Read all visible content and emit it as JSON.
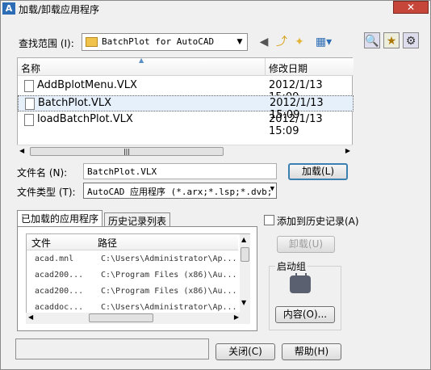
{
  "window": {
    "title": "加载/卸载应用程序",
    "close": "✕"
  },
  "lookin": {
    "label": "查找范围 (I):",
    "value": "BatchPlot for AutoCAD"
  },
  "toolbar": [
    "back-icon",
    "up-folder-icon",
    "new-folder-icon",
    "views-menu-icon",
    "search-web-icon",
    "favorites-icon",
    "tools-icon"
  ],
  "filelist": {
    "col_name": "名称",
    "col_date": "修改日期",
    "rows": [
      {
        "name": "AddBplotMenu.VLX",
        "date": "2012/1/13 15:09"
      },
      {
        "name": "BatchPlot.VLX",
        "date": "2012/1/13 15:09",
        "selected": true
      },
      {
        "name": "loadBatchPlot.VLX",
        "date": "2012/1/13 15:09"
      }
    ]
  },
  "filename": {
    "label": "文件名 (N):",
    "value": "BatchPlot.VLX"
  },
  "filetype": {
    "label": "文件类型 (T):",
    "value": "AutoCAD 应用程序 (*.arx;*.lsp;*.dvb;"
  },
  "load_button": "加载(L)",
  "tabs": {
    "loaded": "已加载的应用程序",
    "history": "历史记录列表"
  },
  "applist": {
    "col_file": "文件",
    "col_path": "路径",
    "rows": [
      {
        "file": "acad.mnl",
        "path": "C:\\Users\\Administrator\\Ap..."
      },
      {
        "file": "acad200...",
        "path": "C:\\Program Files (x86)\\Au..."
      },
      {
        "file": "acad200...",
        "path": "C:\\Program Files (x86)\\Au..."
      },
      {
        "file": "acaddoc...",
        "path": "C:\\Users\\Administrator\\Ap..."
      }
    ]
  },
  "add_history": "添加到历史记录(A)",
  "unload_button": "卸载(U)",
  "startup": {
    "label": "启动组",
    "contents_button": "内容(O)..."
  },
  "close_button": "关闭(C)",
  "help_button": "帮助(H)",
  "colors": {
    "selection": "#e6f0fb",
    "close": "#c7463a"
  }
}
